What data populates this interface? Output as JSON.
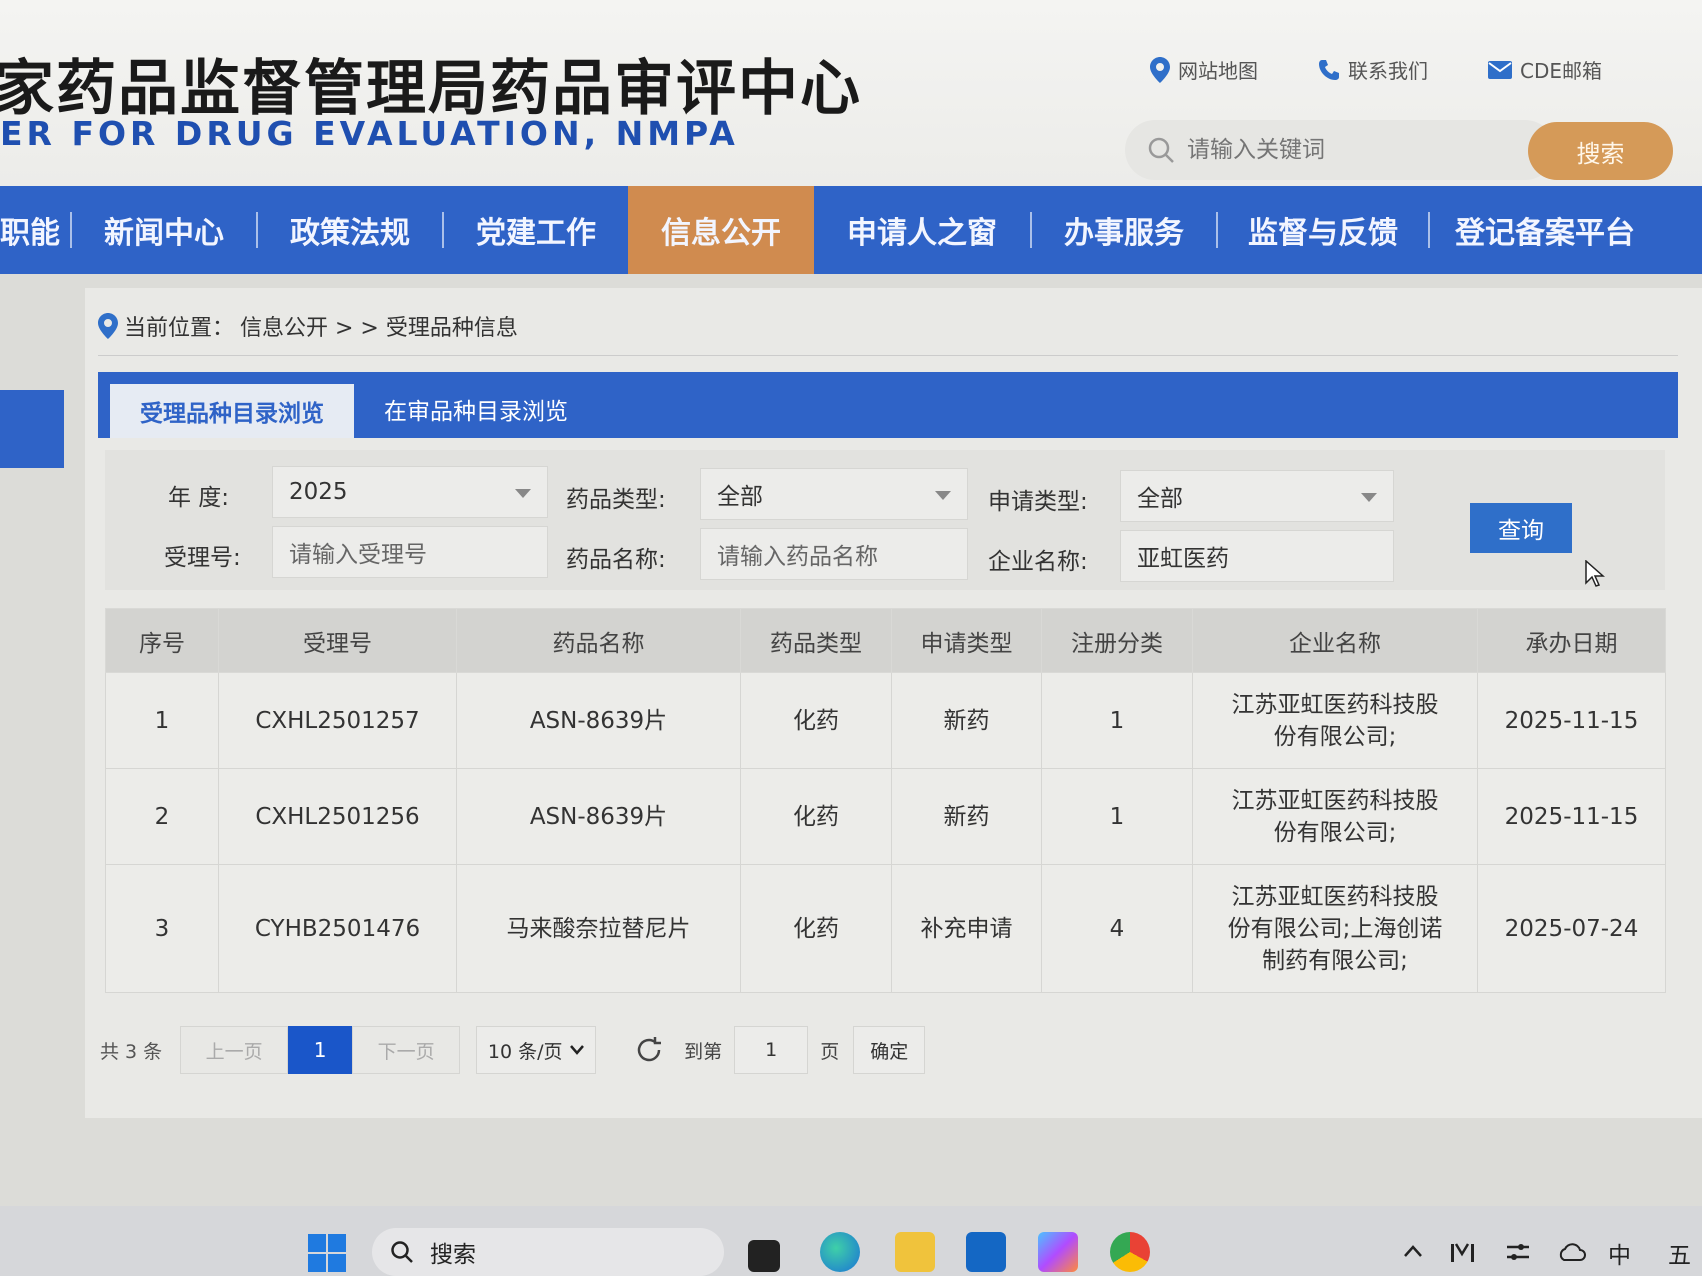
{
  "header": {
    "site_title": "家药品监督管理局药品审评中心",
    "site_subtitle": "ER FOR DRUG EVALUATION, NMPA",
    "links": [
      "网站地图",
      "联系我们",
      "CDE邮箱"
    ],
    "search_placeholder": "请输入关键词",
    "search_button": "搜索"
  },
  "nav": {
    "items": [
      "职能",
      "新闻中心",
      "政策法规",
      "党建工作",
      "信息公开",
      "申请人之窗",
      "办事服务",
      "监督与反馈",
      "登记备案平台"
    ],
    "active": "信息公开"
  },
  "breadcrumb": {
    "prefix": "当前位置：",
    "path": "信息公开 > > 受理品种信息"
  },
  "tabs": [
    "受理品种目录浏览",
    "在审品种目录浏览"
  ],
  "filter": {
    "year_label": "年 度:",
    "year_value": "2025",
    "drug_type_label": "药品类型:",
    "drug_type_value": "全部",
    "apply_type_label": "申请类型:",
    "apply_type_value": "全部",
    "accept_no_label": "受理号:",
    "accept_no_placeholder": "请输入受理号",
    "drug_name_label": "药品名称:",
    "drug_name_placeholder": "请输入药品名称",
    "company_label": "企业名称:",
    "company_value": "亚虹医药",
    "query_button": "查询"
  },
  "table": {
    "headers": [
      "序号",
      "受理号",
      "药品名称",
      "药品类型",
      "申请类型",
      "注册分类",
      "企业名称",
      "承办日期"
    ],
    "rows": [
      [
        "1",
        "CXHL2501257",
        "ASN-8639片",
        "化药",
        "新药",
        "1",
        "江苏亚虹医药科技股份有限公司;",
        "2025-11-15"
      ],
      [
        "2",
        "CXHL2501256",
        "ASN-8639片",
        "化药",
        "新药",
        "1",
        "江苏亚虹医药科技股份有限公司;",
        "2025-11-15"
      ],
      [
        "3",
        "CYHB2501476",
        "马来酸奈拉替尼片",
        "化药",
        "补充申请",
        "4",
        "江苏亚虹医药科技股份有限公司;上海创诺制药有限公司;",
        "2025-07-24"
      ]
    ]
  },
  "pager": {
    "total": "共 3 条",
    "prev": "上一页",
    "current": "1",
    "next": "下一页",
    "page_size": "10 条/页",
    "goto_label": "到第",
    "goto_value": "1",
    "page_suffix": "页",
    "confirm": "确定"
  },
  "taskbar": {
    "search": "搜索",
    "tray": [
      "中",
      "五"
    ]
  },
  "colors": {
    "nav_blue": "#2f63c7",
    "nav_active": "#d08b4f",
    "search_btn": "#d59a58",
    "query_btn": "#2f6fc9"
  }
}
